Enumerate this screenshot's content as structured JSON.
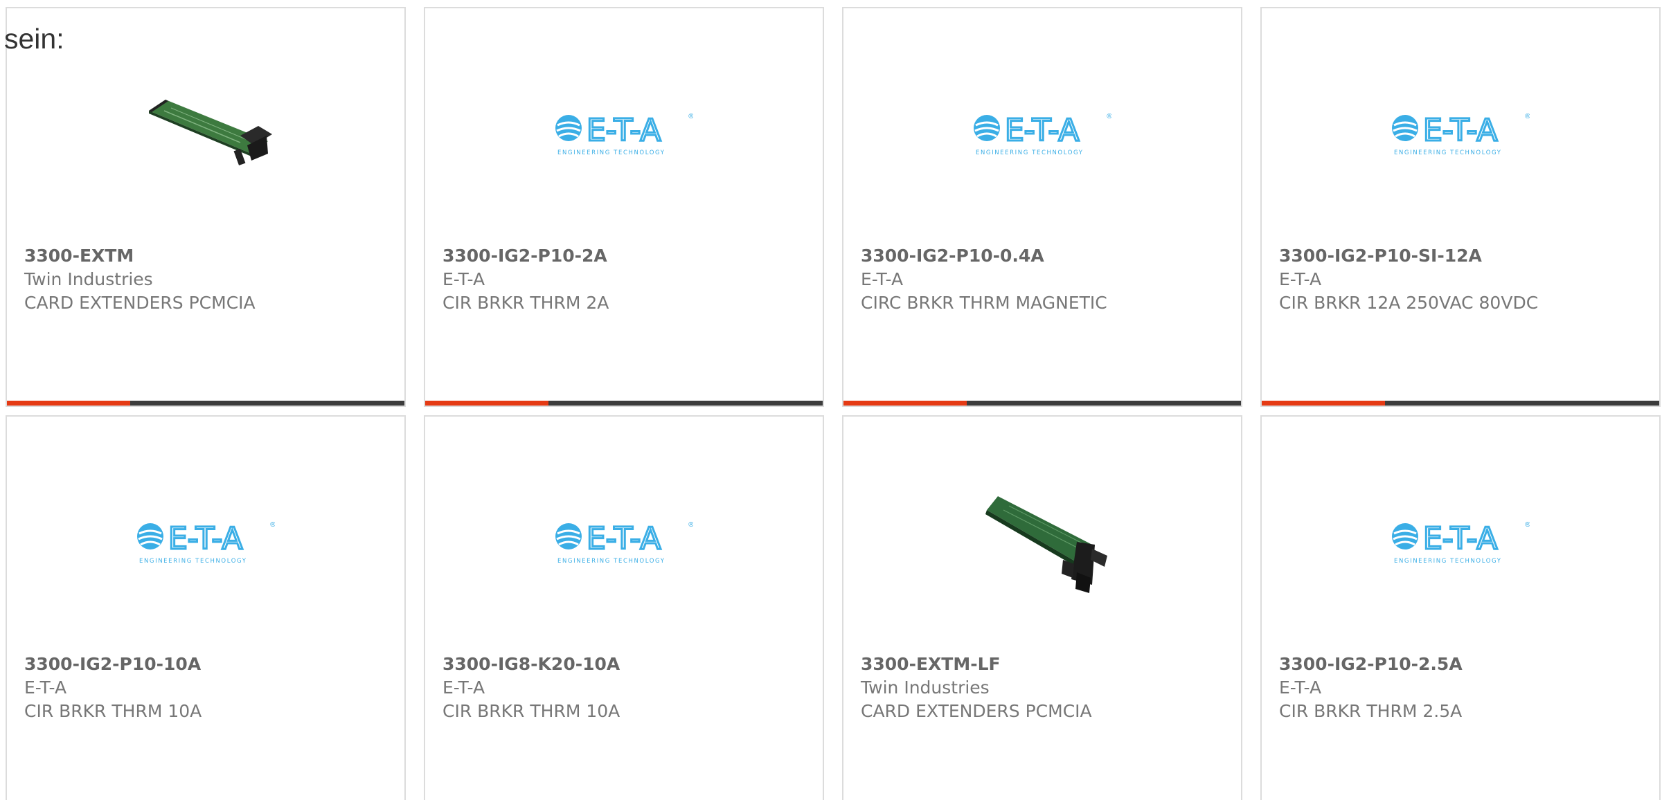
{
  "intro_text": "sein:",
  "colors": {
    "accent": "#e53a14",
    "bar_dark": "#3c3c3c",
    "eta_blue": "#3aaee6",
    "pcb_green": "#2f6b3a"
  },
  "products": [
    {
      "part": "3300-EXTM",
      "manufacturer": "Twin Industries",
      "description": "CARD EXTENDERS PCMCIA",
      "image": "pcb-card-small",
      "progress": 0.31
    },
    {
      "part": "3300-IG2-P10-2A",
      "manufacturer": "E-T-A",
      "description": "CIR BRKR THRM 2A",
      "image": "eta-logo",
      "progress": 0.31
    },
    {
      "part": "3300-IG2-P10-0.4A",
      "manufacturer": "E-T-A",
      "description": "CIRC BRKR THRM MAGNETIC",
      "image": "eta-logo",
      "progress": 0.31
    },
    {
      "part": "3300-IG2-P10-SI-12A",
      "manufacturer": "E-T-A",
      "description": "CIR BRKR 12A 250VAC 80VDC",
      "image": "eta-logo",
      "progress": 0.31
    },
    {
      "part": "3300-IG2-P10-10A",
      "manufacturer": "E-T-A",
      "description": "CIR BRKR THRM 10A",
      "image": "eta-logo"
    },
    {
      "part": "3300-IG8-K20-10A",
      "manufacturer": "E-T-A",
      "description": "CIR BRKR THRM 10A",
      "image": "eta-logo"
    },
    {
      "part": "3300-EXTM-LF",
      "manufacturer": "Twin Industries",
      "description": "CARD EXTENDERS PCMCIA",
      "image": "pcb-card-large"
    },
    {
      "part": "3300-IG2-P10-2.5A",
      "manufacturer": "E-T-A",
      "description": "CIR BRKR THRM 2.5A",
      "image": "eta-logo"
    }
  ],
  "eta_logo": {
    "wordmark": "E-T-A",
    "tagline": "ENGINEERING TECHNOLOGY",
    "registered": "®"
  }
}
